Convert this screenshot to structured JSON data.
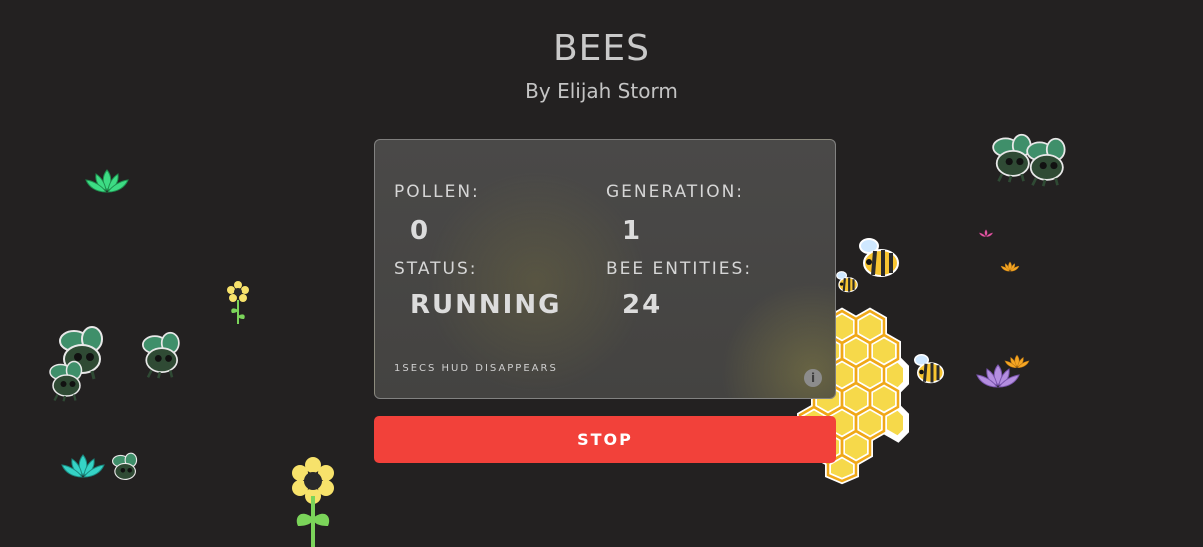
{
  "header": {
    "title": "BEES",
    "byline": "By Elijah Storm"
  },
  "hud": {
    "pollen_label": "POLLEN:",
    "pollen_value": "0",
    "generation_label": "GENERATION:",
    "generation_value": "1",
    "status_label": "STATUS:",
    "status_value": "RUNNING",
    "bee_entities_label": "BEE ENTITIES:",
    "bee_entities_value": "24",
    "note": "1SECS HUD DISAPPEARS",
    "info_icon": "info-icon"
  },
  "controls": {
    "stop_label": "STOP"
  },
  "colors": {
    "background": "#232121",
    "stop_button": "#f2413a",
    "honeycomb": "#f6d94a",
    "honeycomb_border": "#f0a818"
  },
  "scene_icons": [
    "bee-icon",
    "zombie-bee-icon",
    "lotus-icon",
    "flower-icon",
    "honeycomb-icon"
  ]
}
